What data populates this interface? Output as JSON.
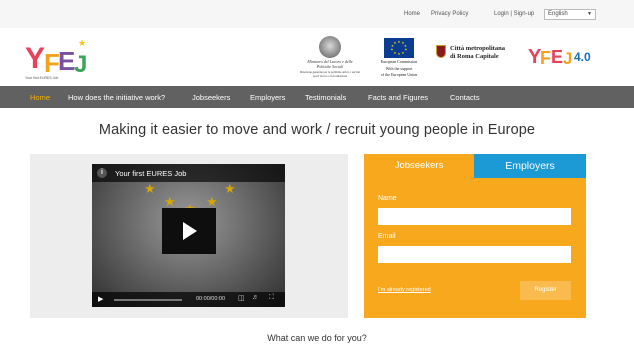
{
  "topbar": {
    "home": "Home",
    "privacy": "Privacy Policy",
    "login": "Login | Sign-up",
    "language": "English"
  },
  "header": {
    "logo_sub": "Your first EURES Job",
    "ministero_text": "Ministero del Lavoro e delle Politiche Sociali",
    "ministero_sub": "Direzione generale per le politiche attive, i servizi per il lavoro e la formazione",
    "eu_text_1": "European Commission",
    "eu_text_2": "With the support",
    "eu_text_3": "of the European Union",
    "roma_text_1": "Città metropolitana",
    "roma_text_2": "di Roma Capitale",
    "yfej_version": "4.0"
  },
  "nav": {
    "items": [
      {
        "label": "Home"
      },
      {
        "label": "How does the initiative work?"
      },
      {
        "label": "Jobseekers"
      },
      {
        "label": "Employers"
      },
      {
        "label": "Testimonials"
      },
      {
        "label": "Facts and Figures"
      },
      {
        "label": "Contacts"
      }
    ]
  },
  "headline": "Making it easier to move and work / recruit young people in Europe",
  "video": {
    "title": "Your first EURES Job",
    "time": "00:00/00:00"
  },
  "form": {
    "tab_jobseekers": "Jobseekers",
    "tab_employers": "Employers",
    "name_label": "Name",
    "email_label": "Email",
    "already_registered": "I'm already registered",
    "register_button": "Register"
  },
  "subhead": "What can we do for you?",
  "colors": {
    "nav_bg": "#616161",
    "nav_active": "#f5b400",
    "form_orange": "#f7a81c",
    "employers_blue": "#1b9ad6"
  }
}
